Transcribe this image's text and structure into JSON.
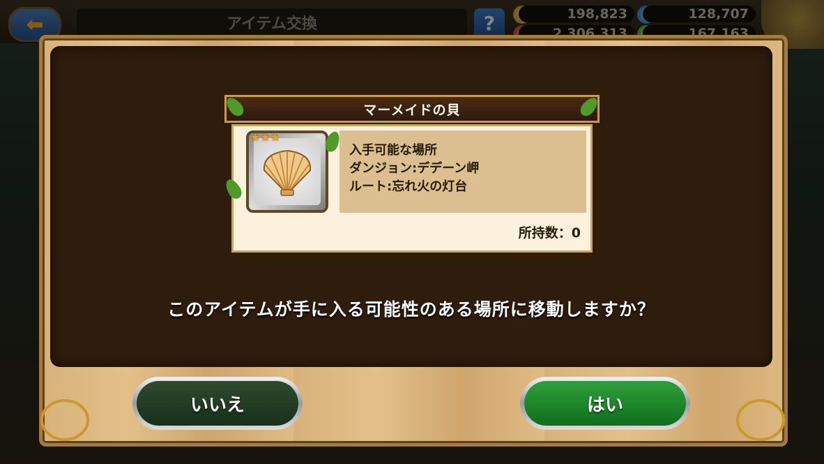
{
  "header": {
    "title": "アイテム交換",
    "help_label": "?",
    "back_label": "⬅",
    "currency_1": "198,823",
    "currency_2": "128,707",
    "currency_3": "2,306,313",
    "currency_4": "167,163"
  },
  "dialog": {
    "item_name": "マーメイドの貝",
    "rarity_stars": 3,
    "stars_text": "★★★",
    "availability_heading": "入手可能な場所",
    "dungeon_line": "ダンジョン:デデーン岬",
    "route_line": "ルート:忘れ火の灯台",
    "owned_count": "所持数：0",
    "question": "このアイテムが手に入る可能性のある場所に移動しますか？",
    "no_label": "いいえ",
    "yes_label": "はい"
  },
  "colors": {
    "panel_dark": "#2e1c0d",
    "wood": "#e3c08a",
    "yes_green": "#1f8a2c",
    "no_green": "#234024",
    "star_gold": "#f4a21c"
  },
  "icons": {
    "item": "scallop-shell-icon",
    "back": "arrow-left-icon",
    "help": "question-icon"
  }
}
